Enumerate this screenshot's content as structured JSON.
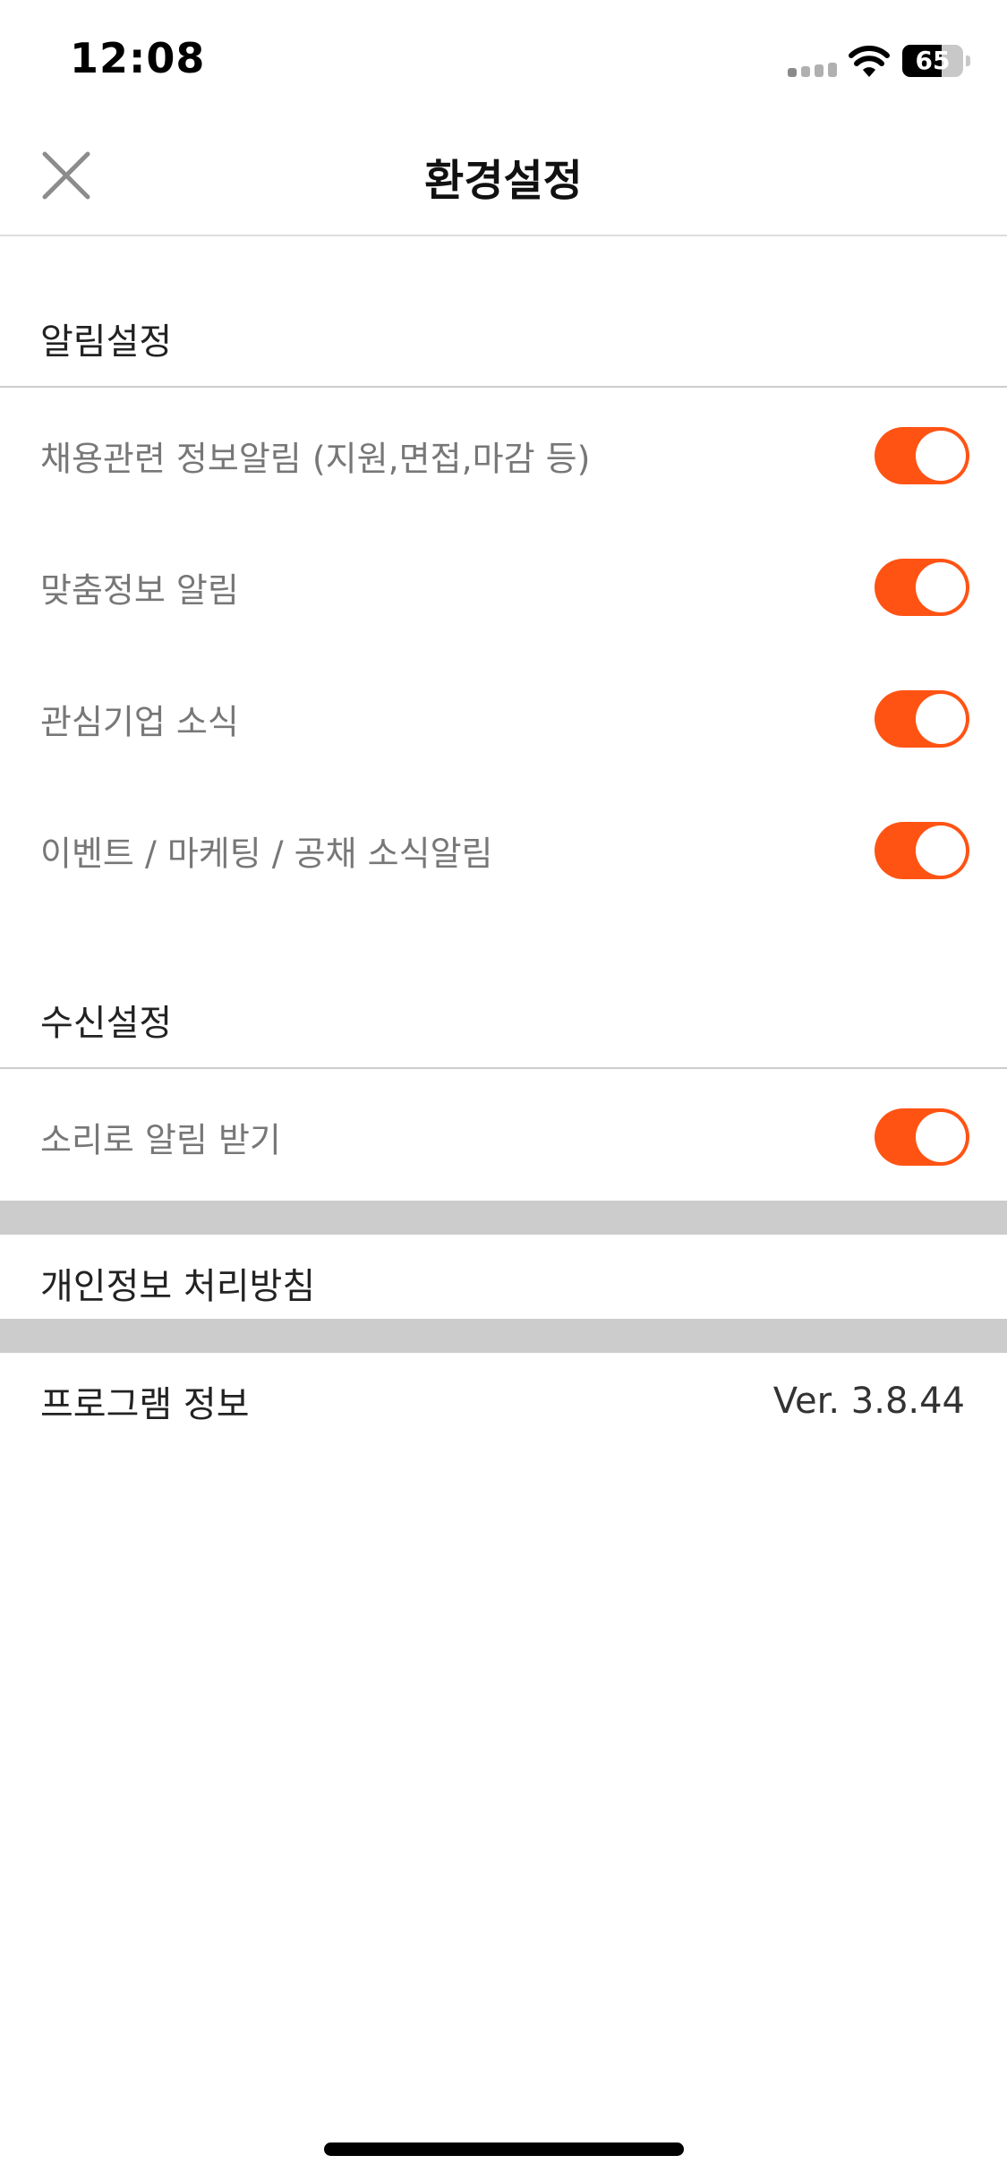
{
  "status_bar": {
    "time": "12:08",
    "battery_level": "65",
    "battery_fraction": 0.65,
    "icons": [
      "signal-icon",
      "wifi-icon",
      "battery-icon"
    ]
  },
  "header": {
    "title": "환경설정",
    "close_icon": "close-icon"
  },
  "notification_settings": {
    "title": "알림설정",
    "items": [
      {
        "label": "채용관련 정보알림 (지원,면접,마감 등)",
        "enabled": true
      },
      {
        "label": "맞춤정보 알림",
        "enabled": true
      },
      {
        "label": "관심기업 소식",
        "enabled": true
      },
      {
        "label": "이벤트 / 마케팅 / 공채 소식알림",
        "enabled": true
      }
    ]
  },
  "receive_settings": {
    "title": "수신설정",
    "items": [
      {
        "label": "소리로 알림 받기",
        "enabled": true
      }
    ]
  },
  "menu": {
    "privacy_policy": "개인정보 처리방침",
    "program_info": {
      "label": "프로그램 정보",
      "version": "Ver. 3.8.44"
    }
  },
  "colors": {
    "accent": "#ff5314",
    "divider": "#cccccc",
    "band": "#cccccc",
    "label_gray": "#777777"
  }
}
